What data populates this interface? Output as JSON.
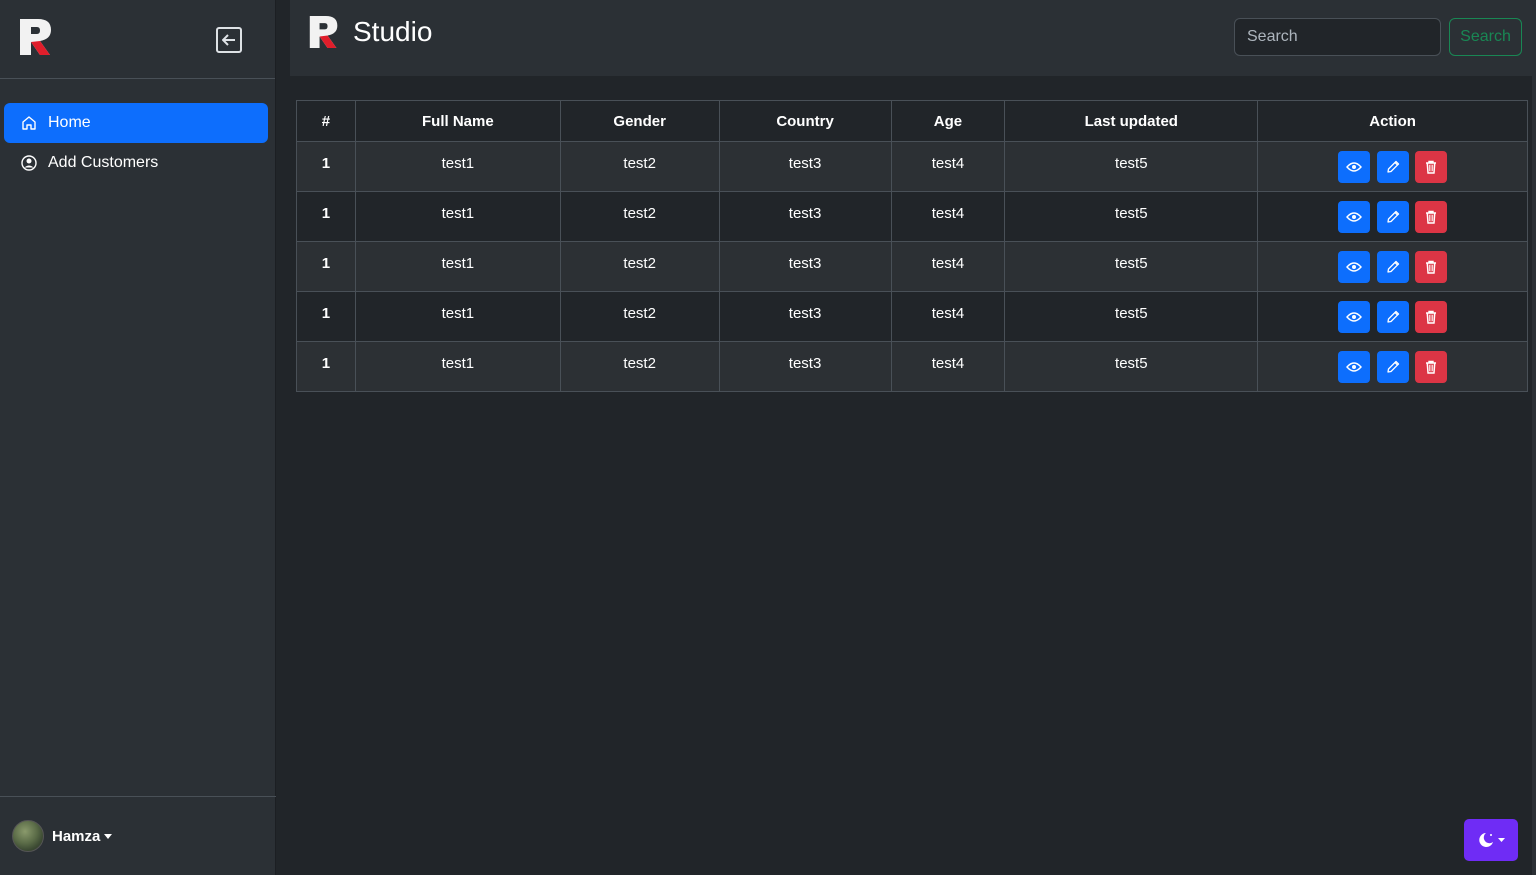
{
  "sidebar": {
    "nav": [
      {
        "label": "Home",
        "icon": "home-icon",
        "active": true
      },
      {
        "label": "Add Customers",
        "icon": "user-circle-icon",
        "active": false
      }
    ],
    "user": {
      "name": "Hamza"
    }
  },
  "header": {
    "title": "Studio",
    "search_placeholder": "Search",
    "search_button": "Search"
  },
  "table": {
    "columns": [
      "#",
      "Full Name",
      "Gender",
      "Country",
      "Age",
      "Last updated",
      "Action"
    ],
    "rows": [
      {
        "num": "1",
        "name": "test1",
        "gender": "test2",
        "country": "test3",
        "age": "test4",
        "updated": "test5"
      },
      {
        "num": "1",
        "name": "test1",
        "gender": "test2",
        "country": "test3",
        "age": "test4",
        "updated": "test5"
      },
      {
        "num": "1",
        "name": "test1",
        "gender": "test2",
        "country": "test3",
        "age": "test4",
        "updated": "test5"
      },
      {
        "num": "1",
        "name": "test1",
        "gender": "test2",
        "country": "test3",
        "age": "test4",
        "updated": "test5"
      },
      {
        "num": "1",
        "name": "test1",
        "gender": "test2",
        "country": "test3",
        "age": "test4",
        "updated": "test5"
      }
    ]
  },
  "colors": {
    "primary": "#0d6efd",
    "danger": "#dc3545",
    "success": "#198754",
    "theme_toggle": "#6f2cf5",
    "logo_red": "#e01e2b"
  }
}
